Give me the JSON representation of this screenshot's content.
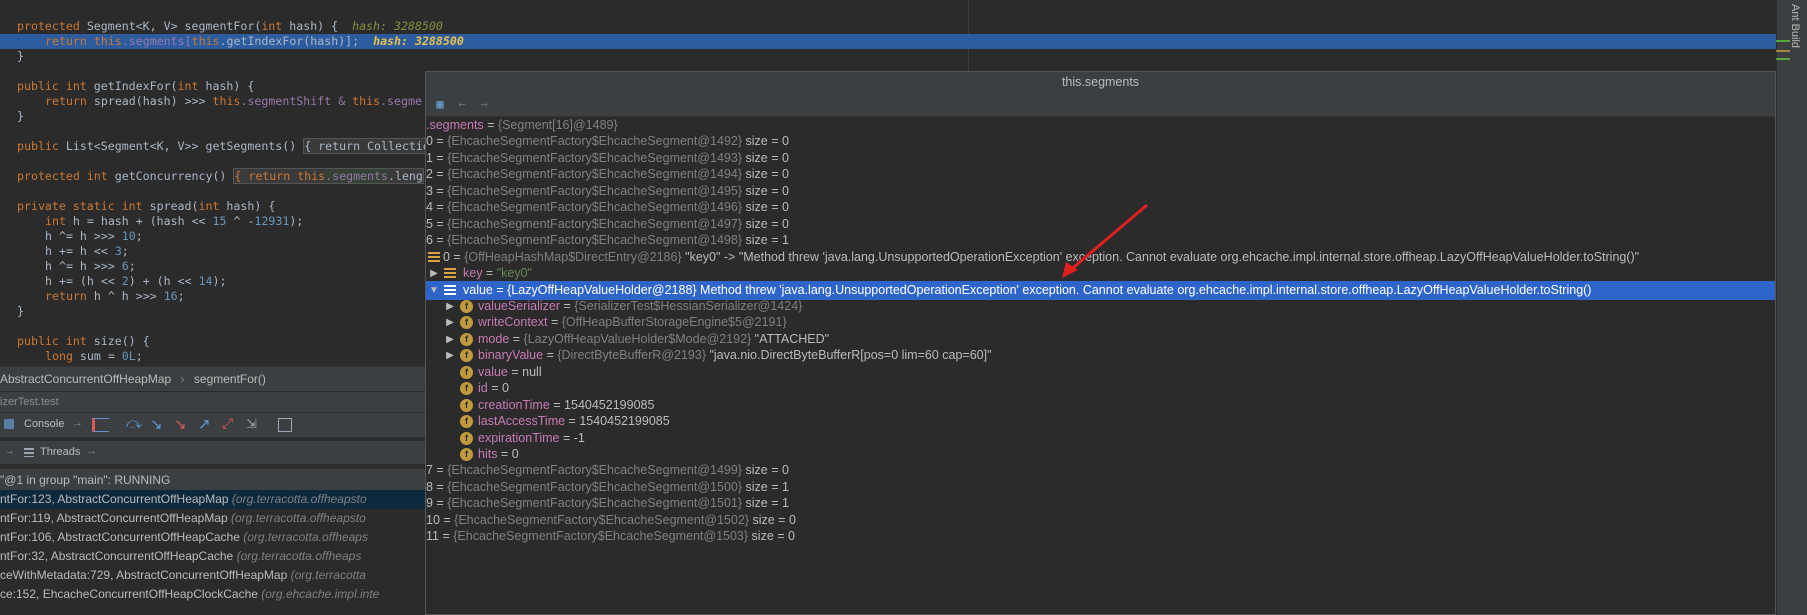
{
  "editor": {
    "line1": {
      "prefix": "protected ",
      "type": "Segment<K, V> ",
      "method": "segmentFor(",
      "kw": "int",
      "rest": " hash) {  ",
      "hint": "hash: 3288500"
    },
    "line2": {
      "kw": "return ",
      "this1": "this",
      "f1": ".segments[",
      "this2": "this",
      "rest": ".getIndexFor(hash)];  ",
      "hint": "hash: 3288500"
    },
    "line3": "}",
    "line5": {
      "kw": "public int ",
      "rest": "getIndexFor(",
      "kw2": "int",
      "rest2": " hash) {"
    },
    "line6": {
      "kw": "return ",
      "rest": "spread(hash) >>> ",
      "this1": "this",
      "f1": ".segmentShift & ",
      "this2": "this",
      "f2": ".segme"
    },
    "line7": "}",
    "line9": {
      "kw": "public ",
      "rest": "List<Segment<K, V>> getSegments() ",
      "fold": "{ return Collectio"
    },
    "line11": {
      "kw": "protected int ",
      "rest": "getConcurrency() ",
      "fold": "{ return ",
      "this1": "this",
      "f1": ".segments",
      "rest2": ".leng"
    },
    "line13": {
      "kw": "private static int ",
      "rest": "spread(",
      "kw2": "int",
      "rest2": " hash) {"
    },
    "line14": {
      "kw": "int ",
      "rest": "h = hash + (hash << ",
      "n1": "15",
      "rest2": " ^ -",
      "n2": "12931",
      "rest3": ");"
    },
    "line15": {
      "rest": "h ^= h >>> ",
      "n": "10",
      "end": ";"
    },
    "line16": {
      "rest": "h += h << ",
      "n": "3",
      "end": ";"
    },
    "line17": {
      "rest": "h ^= h >>> ",
      "n": "6",
      "end": ";"
    },
    "line18": {
      "rest": "h += (h << ",
      "n1": "2",
      "mid": ") + (h << ",
      "n2": "14",
      "end": ");"
    },
    "line19": {
      "kw": "return ",
      "rest": "h ^ h >>> ",
      "n": "16",
      "end": ";"
    },
    "line20": "}",
    "line22": {
      "kw": "public int ",
      "rest": "size() {"
    },
    "line23": {
      "kw": "long ",
      "rest": "sum = ",
      "n": "0L",
      "end": ";"
    }
  },
  "breadcrumb": {
    "class": "AbstractConcurrentOffHeapMap",
    "method": "segmentFor()"
  },
  "debug": {
    "config": "izerTest.test",
    "console_tab": "Console",
    "threads_tab": "Threads",
    "thread": "\"@1 in group \"main\": RUNNING",
    "frames": [
      {
        "loc": "ntFor:123, AbstractConcurrentOffHeapMap ",
        "pkg": "(org.terracotta.offheapsto"
      },
      {
        "loc": "ntFor:119, AbstractConcurrentOffHeapMap ",
        "pkg": "(org.terracotta.offheapsto"
      },
      {
        "loc": "ntFor:106, AbstractConcurrentOffHeapCache ",
        "pkg": "(org.terracotta.offheaps"
      },
      {
        "loc": "ntFor:32, AbstractConcurrentOffHeapCache ",
        "pkg": "(org.terracotta.offheaps"
      },
      {
        "loc": "ceWithMetadata:729, AbstractConcurrentOffHeapMap ",
        "pkg": "(org.terracotta"
      },
      {
        "loc": "ce:152, EhcacheConcurrentOffHeapClockCache ",
        "pkg": "(org.ehcache.impl.inte"
      }
    ]
  },
  "side": {
    "ant_build": "Ant Build"
  },
  "popup": {
    "title": "this.segments",
    "root": {
      "name": ".segments",
      "eq": " = ",
      "type": "{Segment[16]@1489}"
    },
    "segments_top": [
      {
        "idx": "0",
        "type": "{EhcacheSegmentFactory$EhcacheSegment@1492}",
        "size": "size = 0"
      },
      {
        "idx": "1",
        "type": "{EhcacheSegmentFactory$EhcacheSegment@1493}",
        "size": "size = 0"
      },
      {
        "idx": "2",
        "type": "{EhcacheSegmentFactory$EhcacheSegment@1494}",
        "size": "size = 0"
      },
      {
        "idx": "3",
        "type": "{EhcacheSegmentFactory$EhcacheSegment@1495}",
        "size": "size = 0"
      },
      {
        "idx": "4",
        "type": "{EhcacheSegmentFactory$EhcacheSegment@1496}",
        "size": "size = 0"
      },
      {
        "idx": "5",
        "type": "{EhcacheSegmentFactory$EhcacheSegment@1497}",
        "size": "size = 0"
      },
      {
        "idx": "6",
        "type": "{EhcacheSegmentFactory$EhcacheSegment@1498}",
        "size": "size = 1"
      }
    ],
    "entry": {
      "idx": "0",
      "eq": " = ",
      "type": "{OffHeapHashMap$DirectEntry@2186}",
      "text": " \"key0\" -> \"Method threw 'java.lang.UnsupportedOperationException' exception. Cannot evaluate org.ehcache.impl.internal.store.offheap.LazyOffHeapValueHolder.toString()\""
    },
    "key": {
      "name": "key",
      "eq": " = ",
      "val": "\"key0\""
    },
    "value": {
      "name": "value",
      "text": " = {LazyOffHeapValueHolder@2188} Method threw 'java.lang.UnsupportedOperationException' exception. Cannot evaluate org.ehcache.impl.internal.store.offheap.LazyOffHeapValueHolder.toString()"
    },
    "fields": [
      {
        "name": "valueSerializer",
        "eq": " = ",
        "type": "{SerializerTest$HessianSerializer@1424}",
        "val": "",
        "expand": "▶"
      },
      {
        "name": "writeContext",
        "eq": " = ",
        "type": "{OffHeapBufferStorageEngine$5@2191}",
        "val": "",
        "expand": "▶"
      },
      {
        "name": "mode",
        "eq": " = ",
        "type": "{LazyOffHeapValueHolder$Mode@2192}",
        "val": " \"ATTACHED\"",
        "expand": "▶"
      },
      {
        "name": "binaryValue",
        "eq": " = ",
        "type": "{DirectByteBufferR@2193}",
        "val": " \"java.nio.DirectByteBufferR[pos=0 lim=60 cap=60]\"",
        "expand": "▶"
      },
      {
        "name": "value",
        "eq": " = ",
        "type": "",
        "val": "null",
        "expand": ""
      },
      {
        "name": "id",
        "eq": " = ",
        "type": "",
        "val": "0",
        "expand": ""
      },
      {
        "name": "creationTime",
        "eq": " = ",
        "type": "",
        "val": "1540452199085",
        "expand": ""
      },
      {
        "name": "lastAccessTime",
        "eq": " = ",
        "type": "",
        "val": "1540452199085",
        "expand": ""
      },
      {
        "name": "expirationTime",
        "eq": " = ",
        "type": "",
        "val": "-1",
        "expand": ""
      },
      {
        "name": "hits",
        "eq": " = ",
        "type": "",
        "val": "0",
        "expand": ""
      }
    ],
    "segments_bottom": [
      {
        "idx": "7",
        "type": "{EhcacheSegmentFactory$EhcacheSegment@1499}",
        "size": "size = 0"
      },
      {
        "idx": "8",
        "type": "{EhcacheSegmentFactory$EhcacheSegment@1500}",
        "size": "size = 1"
      },
      {
        "idx": "9",
        "type": "{EhcacheSegmentFactory$EhcacheSegment@1501}",
        "size": "size = 1"
      },
      {
        "idx": "10",
        "type": "{EhcacheSegmentFactory$EhcacheSegment@1502}",
        "size": "size = 0"
      },
      {
        "idx": "11",
        "type": "{EhcacheSegmentFactory$EhcacheSegment@1503}",
        "size": "size = 0"
      }
    ]
  },
  "colors": {
    "accent": "#2f65ca",
    "annotation": "#e02020"
  }
}
